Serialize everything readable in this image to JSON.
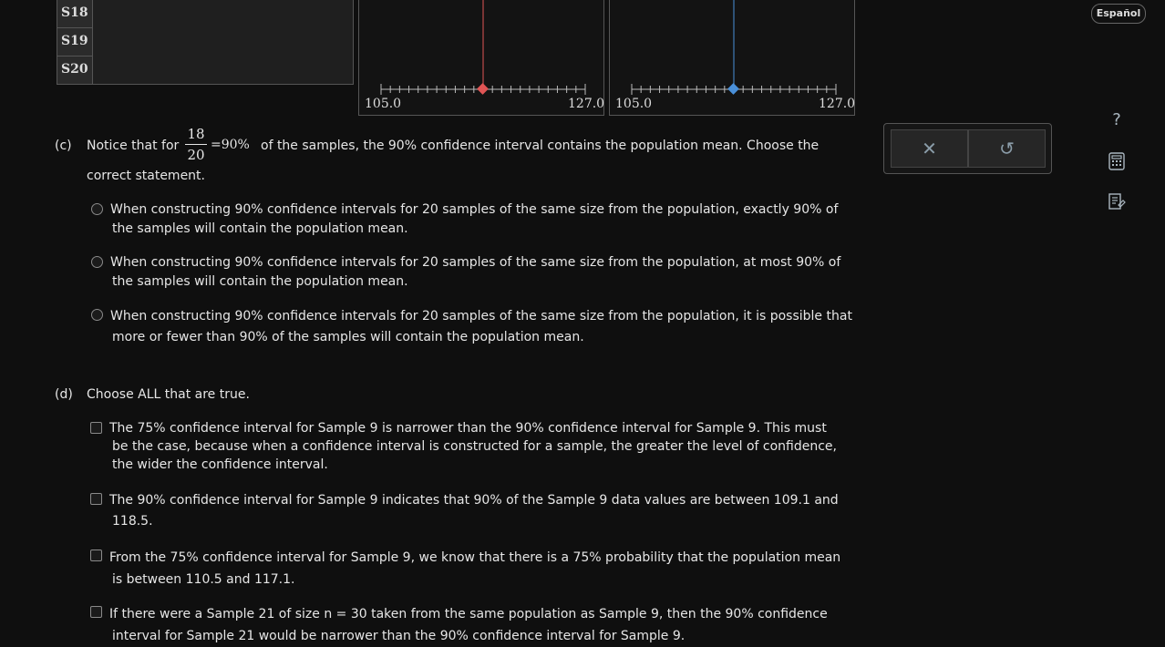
{
  "top_table": {
    "rows": [
      "S18",
      "S19",
      "S20"
    ]
  },
  "plots": [
    {
      "axis_min": "105.0",
      "axis_max": "127.0",
      "line_color": "#e05555"
    },
    {
      "axis_min": "105.0",
      "axis_max": "127.0",
      "line_color": "#4a90d9"
    }
  ],
  "language_button": "Español",
  "actions": {
    "clear_symbol": "✕",
    "undo_symbol": "↺"
  },
  "side_icons": {
    "help": "?",
    "calculator": "calculator-icon",
    "notes": "notes-icon"
  },
  "part_c": {
    "label": "(c)",
    "prefix": "Notice that for",
    "frac_num": "18",
    "frac_den": "20",
    "suffix_eq": "=90%",
    "suffix_rest": "of the samples, the 90% confidence interval contains the population mean. Choose the",
    "line2": "correct statement.",
    "options": [
      {
        "line1": "When constructing 90% confidence intervals for 20 samples of the same size from the population, exactly 90% of",
        "line2": "the samples will contain the population mean."
      },
      {
        "line1": "When constructing 90% confidence intervals for 20 samples of the same size from the population, at most 90% of",
        "line2": "the samples will contain the population mean."
      },
      {
        "line1": "When constructing 90% confidence intervals for 20 samples of the same size from the population, it is possible that",
        "line2": "more or fewer than 90% of the samples will contain the population mean."
      }
    ]
  },
  "part_d": {
    "label": "(d)",
    "prompt": "Choose ALL that are true.",
    "options": [
      {
        "line1": "The 75% confidence interval for Sample 9 is narrower than the 90% confidence interval for Sample 9. This must",
        "line2": "be the case, because when a confidence interval is constructed for a sample, the greater the level of confidence,",
        "line3": "the wider the confidence interval."
      },
      {
        "line1": "The 90% confidence interval for Sample 9 indicates that 90% of the Sample 9 data values are between 109.1 and",
        "line2": "118.5."
      },
      {
        "line1": "From the 75% confidence interval for Sample 9, we know that there is a 75% probability that the population mean",
        "line2": "is between 110.5 and 117.1."
      },
      {
        "line1": "If there were a Sample 21 of size n = 30 taken from the same population as Sample 9, then the 90% confidence",
        "line2": "interval for Sample 21 would be narrower than the 90% confidence interval for Sample 9."
      }
    ]
  }
}
